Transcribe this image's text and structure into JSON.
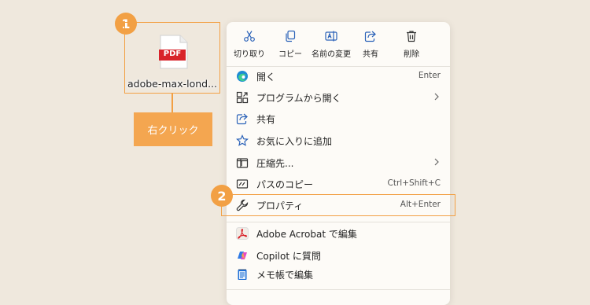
{
  "colors": {
    "accent": "#f2a044",
    "background": "#efe8dd",
    "menu_bg": "#fdfbf7",
    "pdf_red": "#d8232a",
    "icon_blue": "#2b62b8"
  },
  "step1": {
    "number": "1"
  },
  "step2": {
    "number": "2"
  },
  "file": {
    "name": "adobe-max-lond...",
    "type_label": "PDF",
    "icon": "pdf-file-icon"
  },
  "right_click_label": "右クリック",
  "quick_actions": [
    {
      "label": "切り取り",
      "icon": "scissors-icon"
    },
    {
      "label": "コピー",
      "icon": "copy-icon"
    },
    {
      "label": "名前の変更",
      "icon": "rename-icon"
    },
    {
      "label": "共有",
      "icon": "share-icon"
    },
    {
      "label": "削除",
      "icon": "trash-icon"
    }
  ],
  "menu": {
    "open": {
      "label": "開く",
      "shortcut": "Enter",
      "icon": "edge-icon"
    },
    "open_with": {
      "label": "プログラムから開く",
      "icon": "open-with-icon"
    },
    "share": {
      "label": "共有",
      "icon": "share-icon"
    },
    "favorites": {
      "label": "お気に入りに追加",
      "icon": "star-icon"
    },
    "compress": {
      "label": "圧縮先...",
      "icon": "zip-icon"
    },
    "copy_path": {
      "label": "パスのコピー",
      "shortcut": "Ctrl+Shift+C",
      "icon": "path-icon"
    },
    "properties": {
      "label": "プロパティ",
      "shortcut": "Alt+Enter",
      "icon": "wrench-icon"
    },
    "acrobat": {
      "label": "Adobe Acrobat で編集",
      "icon": "acrobat-icon"
    },
    "copilot": {
      "label": "Copilot に質問",
      "icon": "copilot-icon"
    },
    "notepad": {
      "label": "メモ帳で編集",
      "icon": "notepad-icon"
    }
  }
}
